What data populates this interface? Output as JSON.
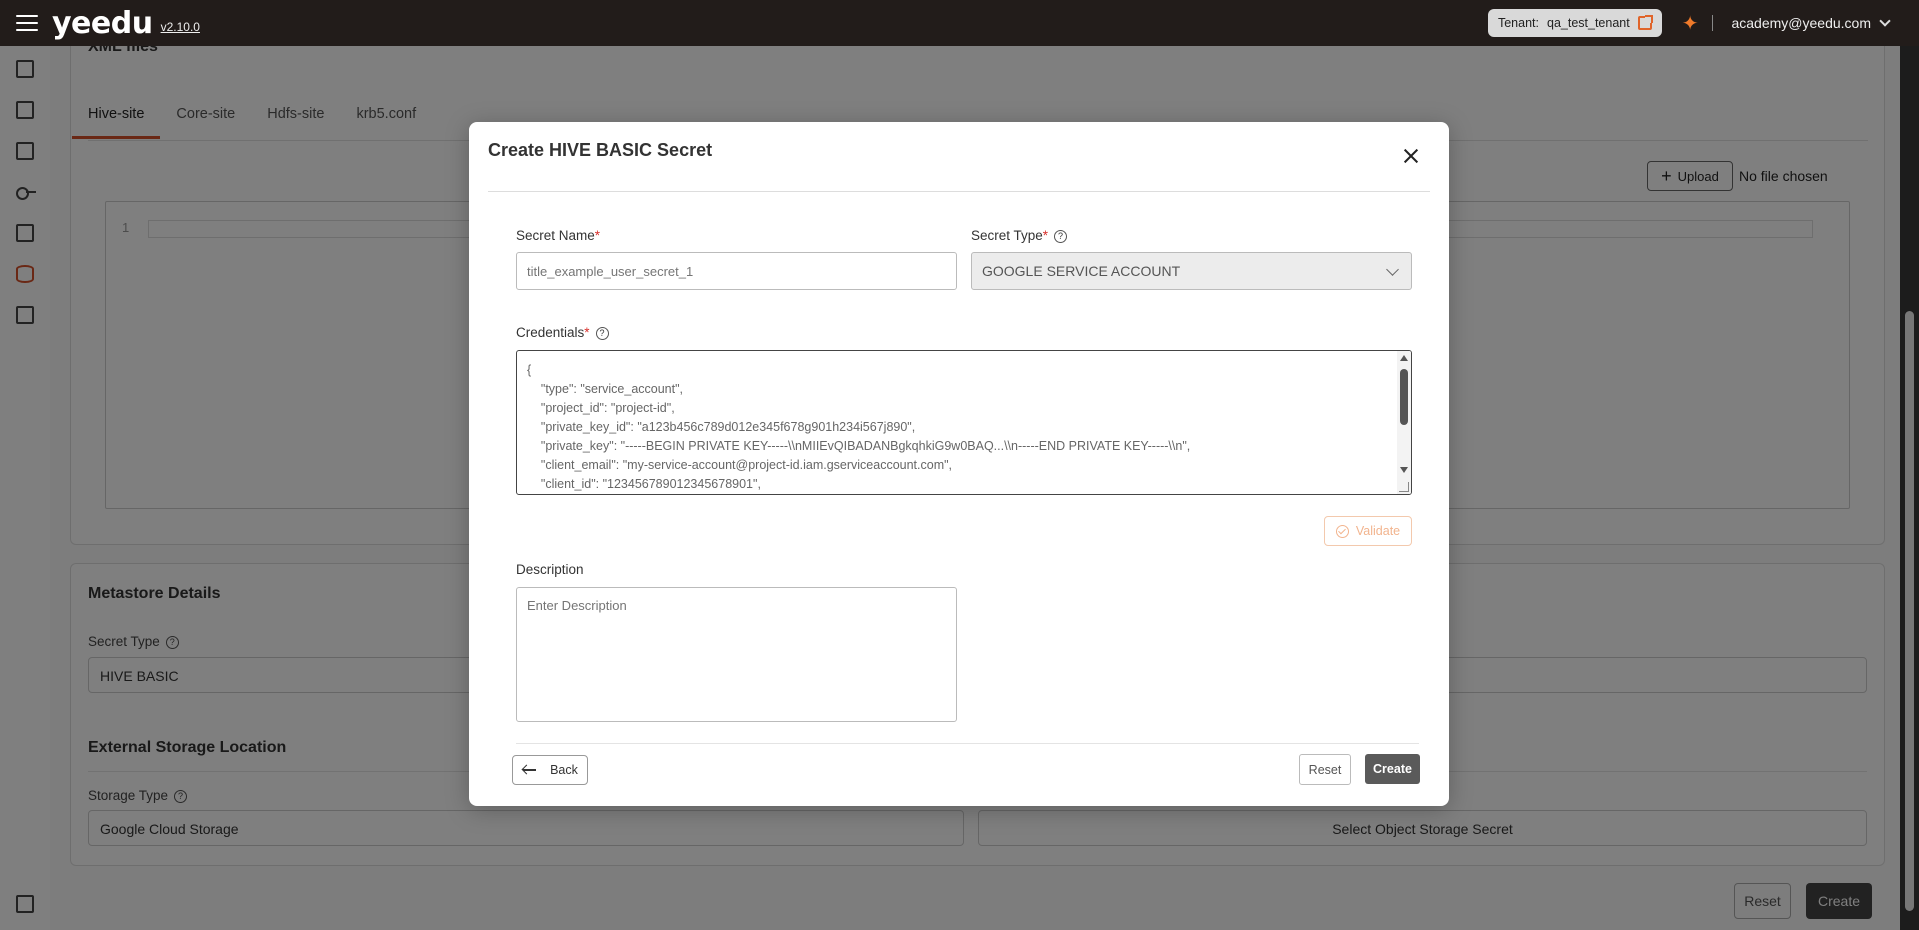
{
  "topbar": {
    "logo": "yeedu",
    "version": "v2.10.0",
    "tenant_label": "Tenant:",
    "tenant_name": "qa_test_tenant",
    "user_email": "academy@yeedu.com"
  },
  "background": {
    "xml_section_title": "XML files",
    "tabs": [
      "Hive-site",
      "Core-site",
      "Hdfs-site",
      "krb5.conf"
    ],
    "upload_label": "Upload",
    "no_file_text": "No file chosen",
    "editor_line_number": "1",
    "metastore_title": "Metastore Details",
    "secret_type_label": "Secret Type",
    "secret_type_value": "HIVE BASIC",
    "external_storage_title": "External Storage Location",
    "storage_type_label": "Storage Type",
    "storage_type_value": "Google Cloud Storage",
    "object_storage_placeholder": "Select Object Storage Secret",
    "reset_label": "Reset",
    "create_label": "Create"
  },
  "modal": {
    "title": "Create HIVE BASIC Secret",
    "secret_name_label": "Secret Name",
    "secret_name_placeholder": "title_example_user_secret_1",
    "secret_type_label": "Secret Type",
    "secret_type_value": "GOOGLE SERVICE ACCOUNT",
    "credentials_label": "Credentials",
    "credentials_placeholder": "{\n    \"type\": \"service_account\",\n    \"project_id\": \"project-id\",\n    \"private_key_id\": \"a123b456c789d012e345f678g901h234i567j890\",\n    \"private_key\": \"-----BEGIN PRIVATE KEY-----\\\\nMIIEvQIBADANBgkqhkiG9w0BAQ...\\\\n-----END PRIVATE KEY-----\\\\n\",\n    \"client_email\": \"my-service-account@project-id.iam.gserviceaccount.com\",\n    \"client_id\": \"123456789012345678901\",",
    "validate_label": "Validate",
    "description_label": "Description",
    "description_placeholder": "Enter Description",
    "back_label": "Back",
    "reset_label": "Reset",
    "create_label": "Create",
    "required_marker": "*"
  }
}
